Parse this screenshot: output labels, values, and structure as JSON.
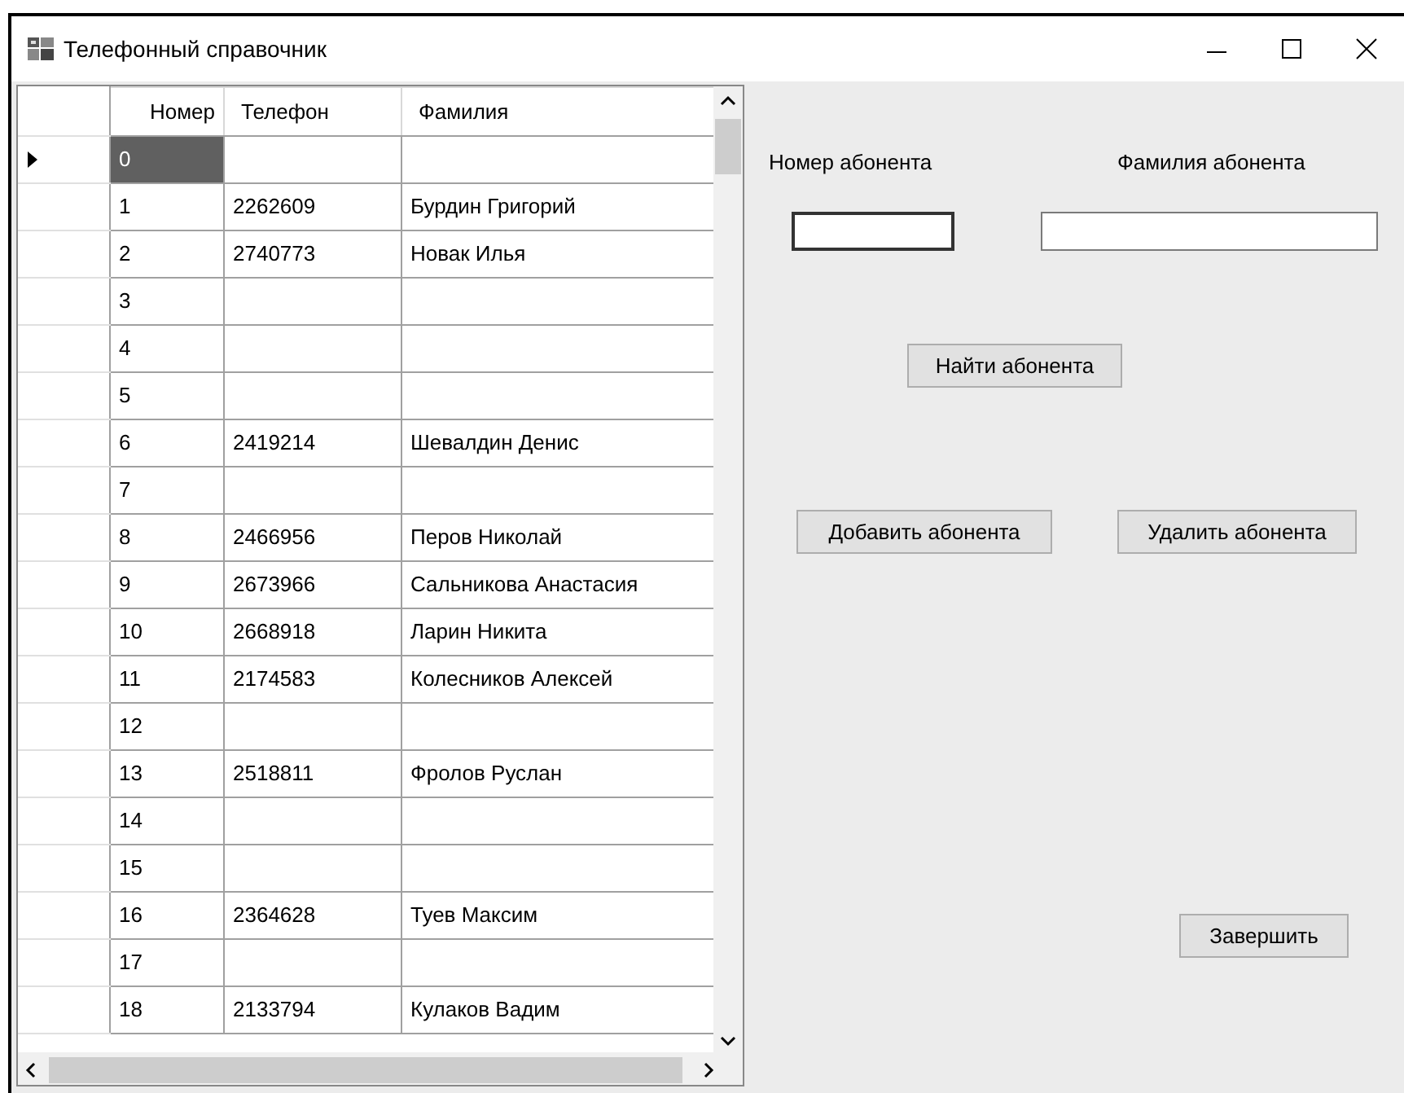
{
  "window": {
    "title": "Телефонный справочник"
  },
  "grid": {
    "columns": [
      "Номер",
      "Телефон",
      "Фамилия"
    ],
    "rows": [
      {
        "cells": [
          "0",
          "",
          ""
        ],
        "selected": true
      },
      {
        "cells": [
          "1",
          "2262609",
          "Бурдин Григорий"
        ],
        "selected": false
      },
      {
        "cells": [
          "2",
          "2740773",
          "Новак Илья"
        ],
        "selected": false
      },
      {
        "cells": [
          "3",
          "",
          ""
        ],
        "selected": false
      },
      {
        "cells": [
          "4",
          "",
          ""
        ],
        "selected": false
      },
      {
        "cells": [
          "5",
          "",
          ""
        ],
        "selected": false
      },
      {
        "cells": [
          "6",
          "2419214",
          "Шевалдин Денис"
        ],
        "selected": false
      },
      {
        "cells": [
          "7",
          "",
          ""
        ],
        "selected": false
      },
      {
        "cells": [
          "8",
          "2466956",
          "Перов Николай"
        ],
        "selected": false
      },
      {
        "cells": [
          "9",
          "2673966",
          "Сальникова Анастасия"
        ],
        "selected": false
      },
      {
        "cells": [
          "10",
          "2668918",
          "Ларин Никита"
        ],
        "selected": false
      },
      {
        "cells": [
          "11",
          "2174583",
          "Колесников Алексей"
        ],
        "selected": false
      },
      {
        "cells": [
          "12",
          "",
          ""
        ],
        "selected": false
      },
      {
        "cells": [
          "13",
          "2518811",
          "Фролов Руслан"
        ],
        "selected": false
      },
      {
        "cells": [
          "14",
          "",
          ""
        ],
        "selected": false
      },
      {
        "cells": [
          "15",
          "",
          ""
        ],
        "selected": false
      },
      {
        "cells": [
          "16",
          "2364628",
          "Туев Максим"
        ],
        "selected": false
      },
      {
        "cells": [
          "17",
          "",
          ""
        ],
        "selected": false
      },
      {
        "cells": [
          "18",
          "2133794",
          "Кулаков Вадим"
        ],
        "selected": false
      }
    ]
  },
  "form": {
    "number_label": "Номер абонента",
    "surname_label": "Фамилия абонента",
    "number_field": {
      "focused": true
    },
    "surname_field": {
      "focused": false
    },
    "find_button": "Найти абонента",
    "add_button": "Добавить абонента",
    "delete_button": "Удалить абонента",
    "finish_button": "Завершить"
  }
}
